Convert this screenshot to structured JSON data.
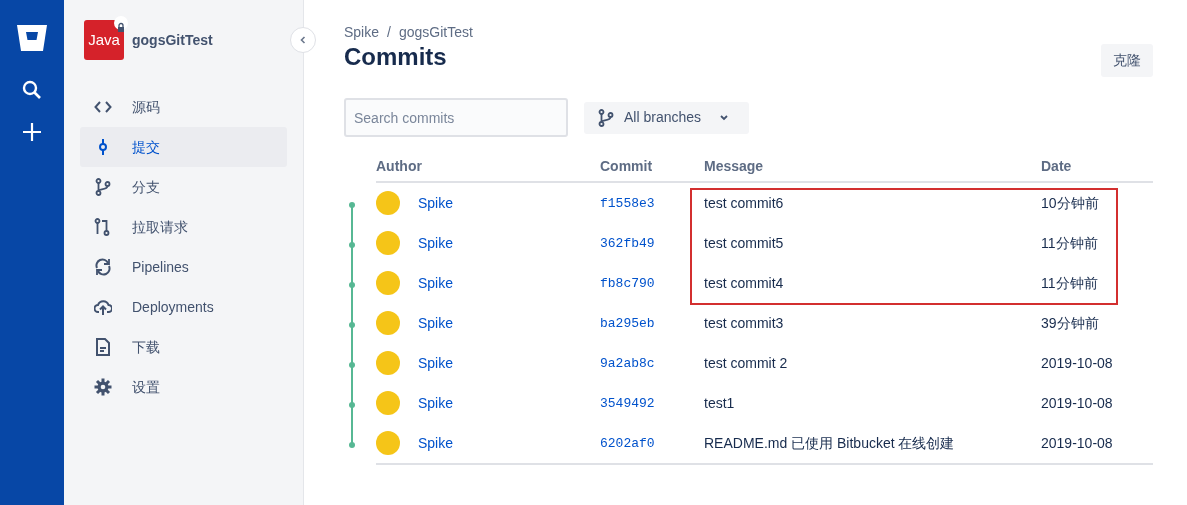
{
  "sidebar": {
    "repo": {
      "name": "gogsGitTest",
      "logo_text": "Java",
      "private": true
    },
    "items": [
      {
        "label": "源码",
        "selected": false
      },
      {
        "label": "提交",
        "selected": true
      },
      {
        "label": "分支",
        "selected": false
      },
      {
        "label": "拉取请求",
        "selected": false
      },
      {
        "label": "Pipelines",
        "selected": false
      },
      {
        "label": "Deployments",
        "selected": false
      },
      {
        "label": "下载",
        "selected": false
      },
      {
        "label": "设置",
        "selected": false
      }
    ]
  },
  "breadcrumb": {
    "items": [
      "Spike",
      "gogsGitTest"
    ],
    "separator": "/"
  },
  "title": "Commits",
  "clone_button": "克隆",
  "search": {
    "placeholder": "Search commits"
  },
  "branch_filter": "All branches",
  "table": {
    "columns": [
      "Author",
      "Commit",
      "Message",
      "Date"
    ],
    "rows": [
      {
        "author": "Spike",
        "commit": "f1558e3",
        "message": "test commit6",
        "date": "10分钟前",
        "highlighted": true
      },
      {
        "author": "Spike",
        "commit": "362fb49",
        "message": "test commit5",
        "date": "11分钟前",
        "highlighted": true
      },
      {
        "author": "Spike",
        "commit": "fb8c790",
        "message": "test commit4",
        "date": "11分钟前",
        "highlighted": true
      },
      {
        "author": "Spike",
        "commit": "ba295eb",
        "message": "test commit3",
        "date": "39分钟前",
        "highlighted": false
      },
      {
        "author": "Spike",
        "commit": "9a2ab8c",
        "message": "test commit 2",
        "date": "2019-10-08",
        "highlighted": false
      },
      {
        "author": "Spike",
        "commit": "3549492",
        "message": "test1",
        "date": "2019-10-08",
        "highlighted": false
      },
      {
        "author": "Spike",
        "commit": "6202af0",
        "message": "README.md 已使用 Bitbucket 在线创建",
        "date": "2019-10-08",
        "highlighted": false
      }
    ]
  }
}
